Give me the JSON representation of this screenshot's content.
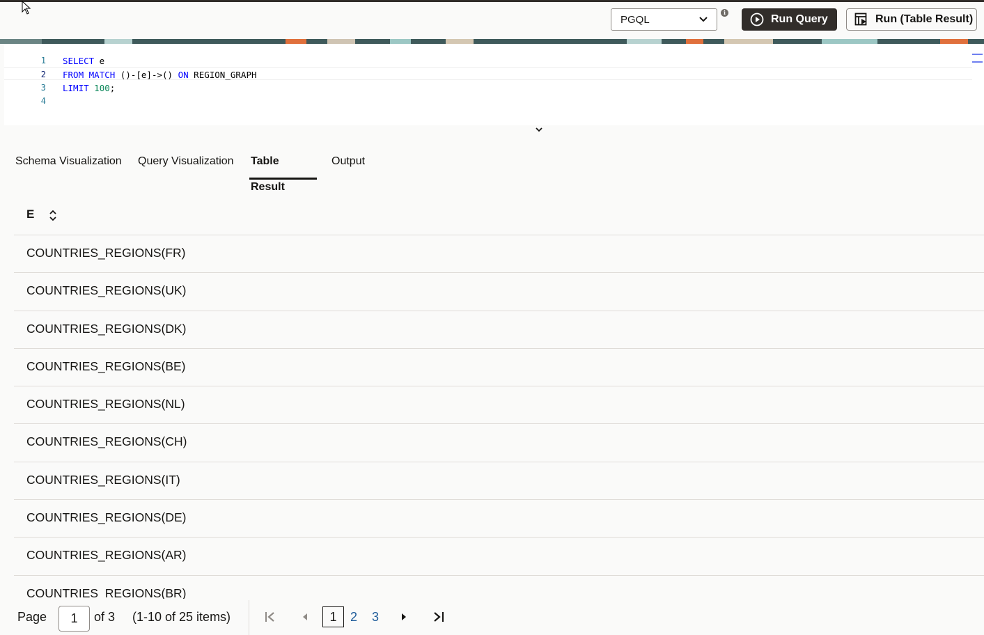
{
  "toolbar": {
    "language": "PGQL",
    "run_query_label": "Run Query",
    "run_table_label": "Run (Table Result)",
    "info_glyph": "i"
  },
  "editor": {
    "lines": [
      {
        "number": "1"
      },
      {
        "number": "2"
      },
      {
        "number": "3"
      },
      {
        "number": "4"
      }
    ],
    "line1": {
      "kw": "SELECT",
      "rest": " e"
    },
    "line2": {
      "kw1": "FROM",
      "kw2": "MATCH",
      "pattern": " ()-[e]->() ",
      "kw3": "ON",
      "rest": " REGION_GRAPH"
    },
    "line3": {
      "kw": "LIMIT",
      "num": "100",
      "rest": ";"
    }
  },
  "tabs": [
    {
      "label": "Schema Visualization"
    },
    {
      "label": "Query Visualization"
    },
    {
      "label": "Table Result"
    },
    {
      "label": "Output"
    }
  ],
  "table": {
    "column": "E",
    "rows": [
      "COUNTRIES_REGIONS(FR)",
      "COUNTRIES_REGIONS(UK)",
      "COUNTRIES_REGIONS(DK)",
      "COUNTRIES_REGIONS(BE)",
      "COUNTRIES_REGIONS(NL)",
      "COUNTRIES_REGIONS(CH)",
      "COUNTRIES_REGIONS(IT)",
      "COUNTRIES_REGIONS(DE)",
      "COUNTRIES_REGIONS(AR)",
      "COUNTRIES_REGIONS(BR)"
    ]
  },
  "pager": {
    "page_label": "Page",
    "page_value": "1",
    "of_label": "of 3",
    "items_label": "(1-10 of 25 items)",
    "pages": [
      "1",
      "2",
      "3"
    ]
  },
  "colors": {
    "primary_button": "#312d2a",
    "link": "#1d5b99",
    "banner": "#3f5a5b"
  }
}
